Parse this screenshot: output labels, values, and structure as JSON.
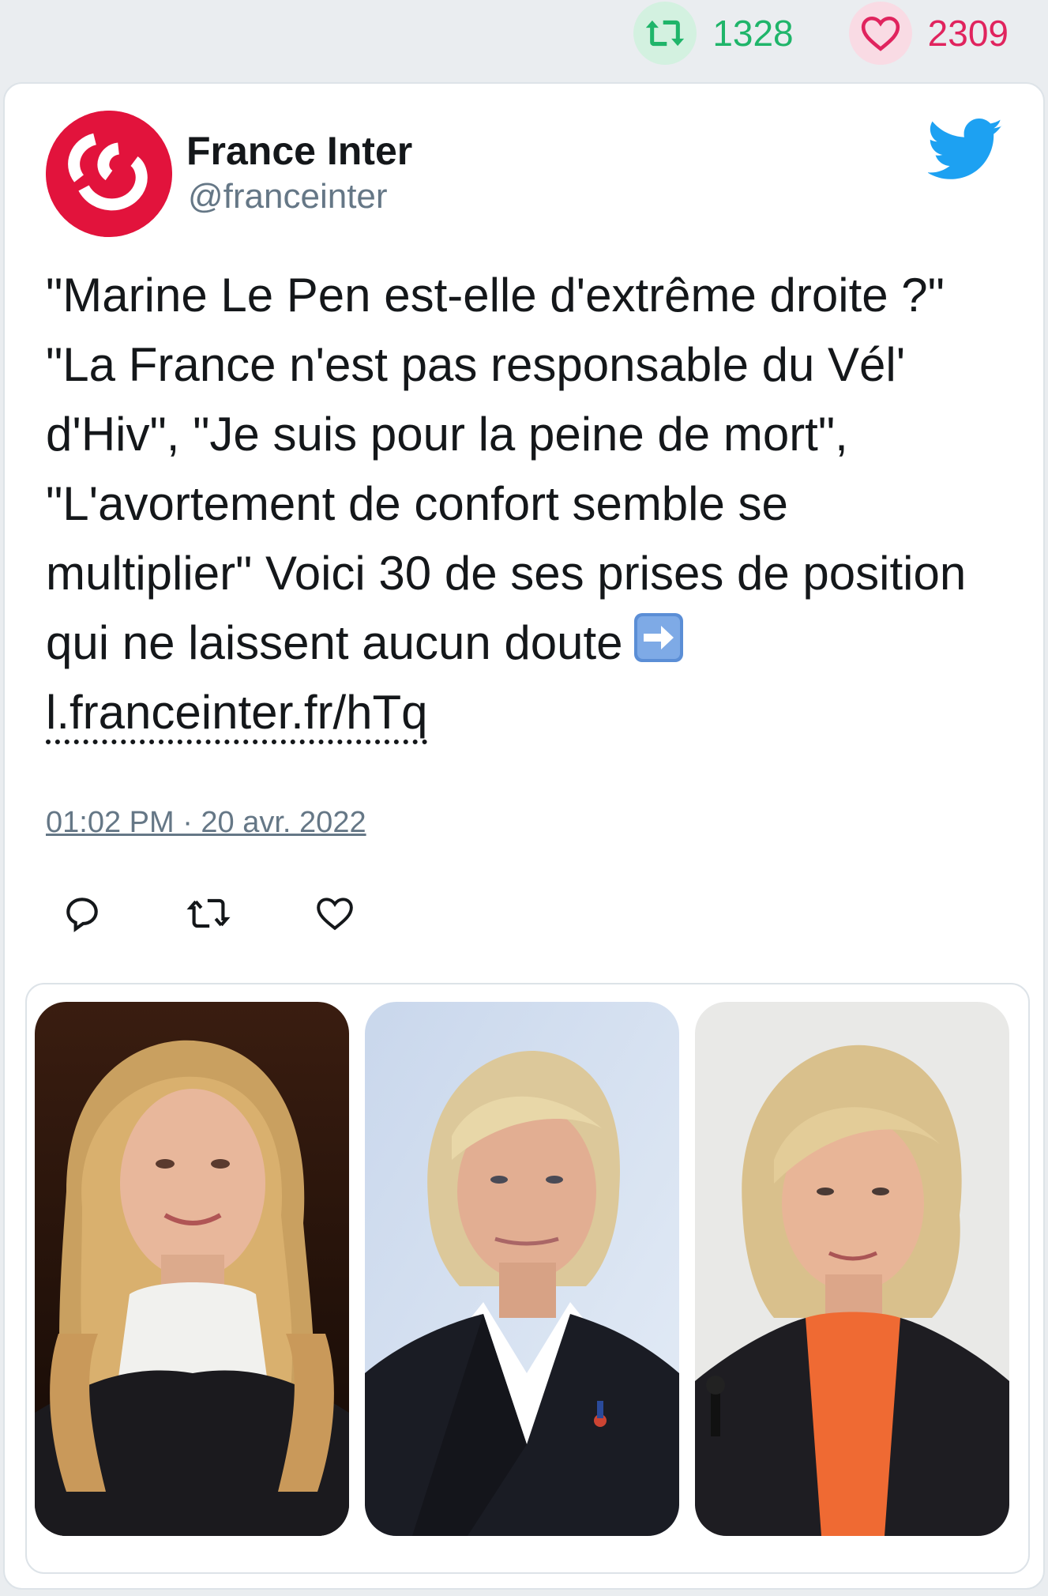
{
  "stats": {
    "retweets": "1328",
    "likes": "2309",
    "retweet_color": "#1fb56a",
    "like_color": "#e0245e"
  },
  "author": {
    "name": "France Inter",
    "handle": "@franceinter",
    "avatar_color": "#e2133c"
  },
  "tweet": {
    "text": "\"Marine Le Pen est-elle d'extrême droite ?\" \"La France n'est pas responsable du Vél' d'Hiv\", \"Je suis pour la peine de mort\", \"L'avortement de confort semble se multiplier\" Voici 30 de ses prises de position qui ne laissent aucun doute",
    "link": "l.franceinter.fr/hTq",
    "timestamp": "01:02 PM · 20 avr. 2022"
  },
  "icons": {
    "stat_retweet": "retweet-icon",
    "stat_like": "heart-icon",
    "brand": "twitter-bird-icon",
    "arrow": "right-arrow-emoji-icon",
    "reply": "reply-icon",
    "retweet": "retweet-icon",
    "like": "heart-icon"
  },
  "media": {
    "count": 3
  }
}
